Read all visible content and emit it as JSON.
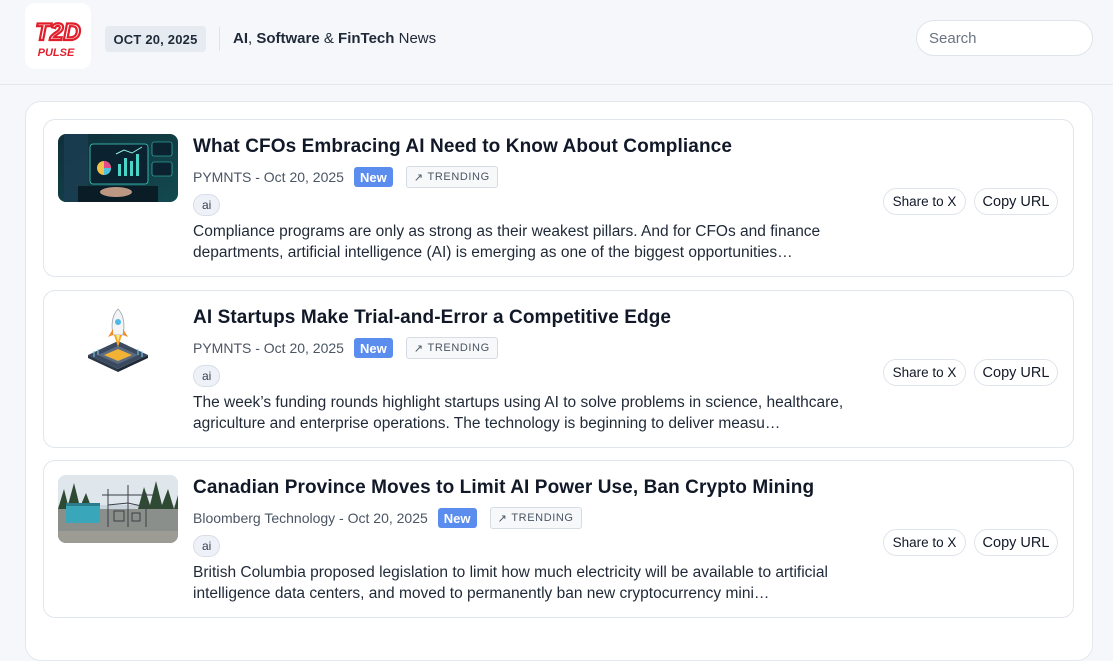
{
  "header": {
    "logo": {
      "text_top": "T2D",
      "text_bottom": "PULSE",
      "color": "#e11d2a"
    },
    "date": "OCT 20, 2025",
    "tagline": {
      "w1": "AI",
      "sep1": ", ",
      "w2": "Software",
      "sep2": " & ",
      "w3": "FinTech",
      "w4": " News"
    },
    "search": {
      "placeholder": "Search",
      "value": ""
    }
  },
  "articles": [
    {
      "title": "What CFOs Embracing AI Need to Know About Compliance",
      "source": "PYMNTS - Oct 20, 2025",
      "badge_new": "New",
      "trending_icon": "↗",
      "badge_trending": "TRENDING",
      "tag": "ai",
      "summary": "Compliance programs are only as strong as their weakest pillars. And for CFOs and finance departments, artificial intelligence (AI) is emerging as one of the biggest opportunities…",
      "share_label": "Share to X",
      "copy_label": "Copy URL"
    },
    {
      "title": "AI Startups Make Trial-and-Error a Competitive Edge",
      "source": "PYMNTS - Oct 20, 2025",
      "badge_new": "New",
      "trending_icon": "↗",
      "badge_trending": "TRENDING",
      "tag": "ai",
      "summary": "The week’s funding rounds highlight startups using AI to solve problems in science, healthcare, agriculture and enterprise operations. The technology is beginning to deliver measu…",
      "share_label": "Share to X",
      "copy_label": "Copy URL"
    },
    {
      "title": "Canadian Province Moves to Limit AI Power Use, Ban Crypto Mining",
      "source": "Bloomberg Technology - Oct 20, 2025",
      "badge_new": "New",
      "trending_icon": "↗",
      "badge_trending": "TRENDING",
      "tag": "ai",
      "summary": "British Columbia proposed legislation to limit how much electricity will be available to artificial intelligence data centers, and moved to permanently ban new cryptocurrency mini…",
      "share_label": "Share to X",
      "copy_label": "Copy URL"
    }
  ]
}
